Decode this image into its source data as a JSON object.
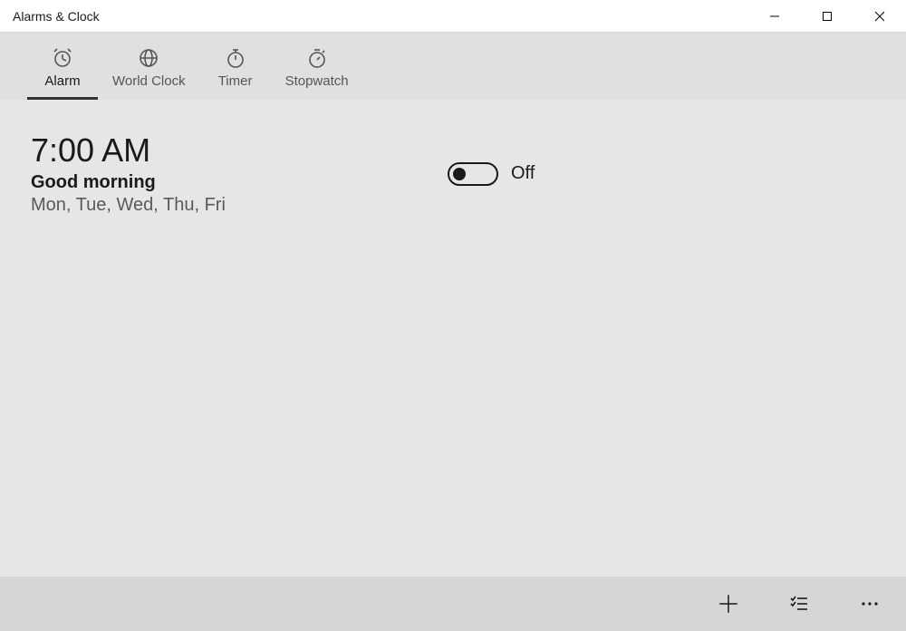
{
  "window": {
    "title": "Alarms & Clock"
  },
  "tabs": {
    "alarm": "Alarm",
    "world_clock": "World Clock",
    "timer": "Timer",
    "stopwatch": "Stopwatch"
  },
  "alarms": [
    {
      "time": "7:00 AM",
      "name": "Good morning",
      "repeat": "Mon, Tue, Wed, Thu, Fri",
      "state_label": "Off"
    }
  ]
}
